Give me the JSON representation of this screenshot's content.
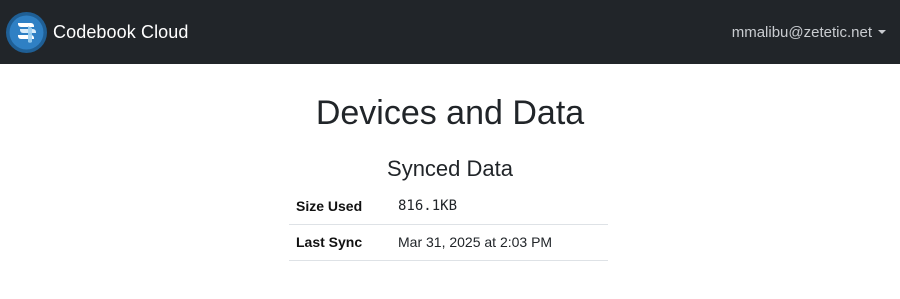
{
  "navbar": {
    "brand_name": "Codebook Cloud",
    "user_email": "mmalibu@zetetic.net",
    "logo_icon": "codebook-logo-icon",
    "caret_icon": "caret-down-icon",
    "background_color": "#212529",
    "logo_color": "#3a8fd0"
  },
  "main": {
    "page_title": "Devices and Data",
    "section_title": "Synced Data",
    "rows": [
      {
        "label": "Size Used",
        "value": "816.1KB"
      },
      {
        "label": "Last Sync",
        "value": "Mar 31, 2025 at 2:03 PM"
      }
    ]
  }
}
